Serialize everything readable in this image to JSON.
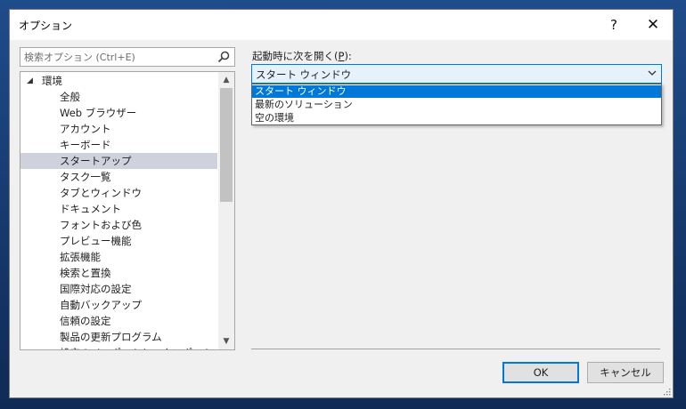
{
  "window": {
    "title": "オプション",
    "help_glyph": "?",
    "close_glyph": "✕"
  },
  "search": {
    "placeholder": "検索オプション (Ctrl+E)"
  },
  "tree": {
    "root": {
      "label": "環境",
      "expanded": true
    },
    "items": [
      {
        "label": "全般"
      },
      {
        "label": "Web ブラウザー"
      },
      {
        "label": "アカウント"
      },
      {
        "label": "キーボード"
      },
      {
        "label": "スタートアップ",
        "selected": true
      },
      {
        "label": "タスク一覧"
      },
      {
        "label": "タブとウィンドウ"
      },
      {
        "label": "ドキュメント"
      },
      {
        "label": "フォントおよび色"
      },
      {
        "label": "プレビュー機能"
      },
      {
        "label": "拡張機能"
      },
      {
        "label": "検索と置換"
      },
      {
        "label": "国際対応の設定"
      },
      {
        "label": "自動バックアップ"
      },
      {
        "label": "信頼の設定"
      },
      {
        "label": "製品の更新プログラム"
      },
      {
        "label": "設定のインポートとエクスポート"
      }
    ]
  },
  "startup": {
    "label_prefix": "起動時に次を開く(",
    "label_key": "P",
    "label_suffix": "):",
    "selected": "スタート ウィンドウ",
    "options": [
      "スタート ウィンドウ",
      "最新のソリューション",
      "空の環境"
    ]
  },
  "buttons": {
    "ok": "OK",
    "cancel": "キャンセル"
  },
  "colors": {
    "accent": "#0078d7",
    "selection": "#cfd2dc"
  }
}
